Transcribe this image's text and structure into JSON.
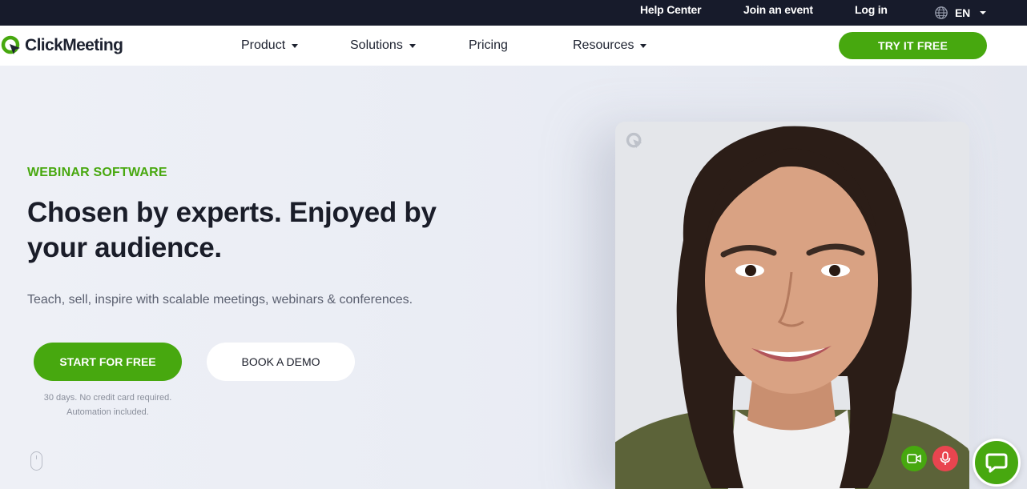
{
  "topbar": {
    "help_center": "Help Center",
    "join_event": "Join an event",
    "log_in": "Log in",
    "language": "EN"
  },
  "nav": {
    "logo_text": "ClickMeeting",
    "items": [
      {
        "label": "Product",
        "dropdown": true
      },
      {
        "label": "Solutions",
        "dropdown": true
      },
      {
        "label": "Pricing",
        "dropdown": false
      },
      {
        "label": "Resources",
        "dropdown": true
      }
    ],
    "cta": "TRY IT FREE"
  },
  "hero": {
    "eyebrow": "WEBINAR SOFTWARE",
    "headline": "Chosen by experts. Enjoyed by your audience.",
    "subtext": "Teach, sell, inspire with scalable meetings, webinars & conferences.",
    "primary_button": "START FOR FREE",
    "secondary_button": "BOOK A DEMO",
    "note_line1": "30 days. No credit card required.",
    "note_line2": "Automation included."
  },
  "icons": {
    "language": "globe-icon",
    "scroll": "scroll-mouse-icon",
    "camera": "video-camera-icon",
    "mic": "microphone-icon",
    "chat": "chat-bubble-icon"
  },
  "colors": {
    "brand_green": "#47a80f",
    "topbar_bg": "#171b2b",
    "mic_red": "#e9454f",
    "headline": "#1a1d29"
  }
}
